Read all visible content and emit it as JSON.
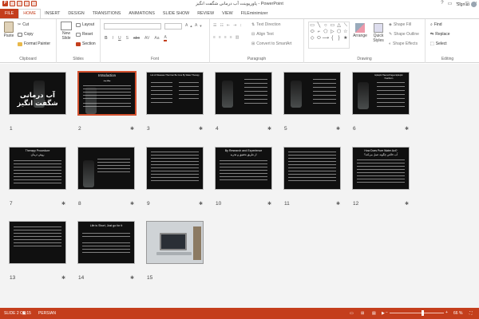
{
  "window": {
    "title": "پاورپوینت آب درمانی شگفت انگیز - PowerPoint",
    "controls": [
      "?",
      "▭",
      "—",
      "▢",
      "✕"
    ],
    "signin": "Sign in"
  },
  "qat": {
    "app_badge": "P"
  },
  "tabs": [
    "FILE",
    "HOME",
    "INSERT",
    "DESIGN",
    "TRANSITIONS",
    "ANIMATIONS",
    "SLIDE SHOW",
    "REVIEW",
    "VIEW",
    "FILEminimizer"
  ],
  "ribbon": {
    "clipboard": {
      "label": "Clipboard",
      "paste": "Paste",
      "cut": "Cut",
      "copy": "Copy",
      "format_painter": "Format Painter"
    },
    "slides": {
      "label": "Slides",
      "new_slide": "New Slide",
      "layout": "Layout",
      "reset": "Reset",
      "section": "Section"
    },
    "font": {
      "label": "Font",
      "buttons": [
        "B",
        "I",
        "U",
        "S",
        "abc",
        "AV",
        "Aa",
        "A"
      ]
    },
    "paragraph": {
      "label": "Paragraph",
      "text_direction": "Text Direction",
      "align_text": "Align Text",
      "convert": "Convert to SmartArt"
    },
    "drawing": {
      "label": "Drawing",
      "shapes": [
        "▭",
        "╲",
        "○",
        "▭",
        "△",
        "⟍",
        "⬭",
        "⌐",
        "⬠",
        "▷",
        "⬡",
        "☆",
        "◇",
        "⬭",
        "⟶",
        "{",
        "}",
        "★"
      ],
      "arrange": "Arrange",
      "quick_styles": "Quick Styles",
      "shape_fill": "Shape Fill",
      "shape_outline": "Shape Outline",
      "shape_effects": "Shape Effects"
    },
    "editing": {
      "label": "Editing",
      "find": "Find",
      "replace": "Replace",
      "select": "Select"
    }
  },
  "slides": [
    {
      "num": "1",
      "title": "آب درمانی شگفت انگیز"
    },
    {
      "num": "2",
      "title": "Introduction",
      "subtitle": "مقدمه",
      "selected": true
    },
    {
      "num": "3",
      "title": "List of Diseases That Can Be Cure By Water Therapy"
    },
    {
      "num": "4"
    },
    {
      "num": "5"
    },
    {
      "num": "6",
      "title": "Epileptic Haemorrhages Epileptic Heartburn"
    },
    {
      "num": "7",
      "title": "Therapy Procedure",
      "subtitle": "روش درمان"
    },
    {
      "num": "8"
    },
    {
      "num": "9"
    },
    {
      "num": "10",
      "title": "By Research and Experience",
      "subtitle": "از طریق تحقیق و تجربه"
    },
    {
      "num": "11"
    },
    {
      "num": "12",
      "title": "How Does Pure Water Act?",
      "subtitle": "آب خالص چگونه عمل می‌کند؟"
    },
    {
      "num": "13"
    },
    {
      "num": "14",
      "title": "Life is Short, Just go for it"
    },
    {
      "num": "15"
    }
  ],
  "status": {
    "slide": "SLIDE 2 OF 15",
    "language": "PERSIAN",
    "zoom": "66 %"
  }
}
